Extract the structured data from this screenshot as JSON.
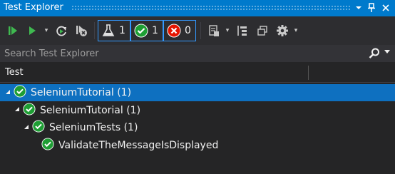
{
  "window": {
    "title": "Test Explorer"
  },
  "title_buttons": {
    "dropdown": "▾",
    "pin": "📌",
    "close": "✕"
  },
  "toolbar": {
    "run_all_icon": "run-all-icon",
    "run_icon": "run-icon",
    "repeat_icon": "repeat-run-icon",
    "cancel_icon": "cancel-icon",
    "filters": [
      {
        "icon": "flask-icon",
        "count": "1"
      },
      {
        "icon": "passed-icon",
        "count": "1"
      },
      {
        "icon": "failed-icon",
        "count": "0"
      }
    ],
    "caret": "▾"
  },
  "search": {
    "placeholder": "Search Test Explorer"
  },
  "header": {
    "test_col": "Test"
  },
  "tree": [
    {
      "label": "SeleniumTutorial  (1)",
      "level": 0,
      "selected": true
    },
    {
      "label": "SeleniumTutorial  (1)",
      "level": 1,
      "selected": false
    },
    {
      "label": "SeleniumTests  (1)",
      "level": 2,
      "selected": false
    },
    {
      "label": "ValidateTheMessageIsDisplayed",
      "level": 3,
      "selected": false
    }
  ],
  "colors": {
    "accent": "#007acc",
    "selection": "#0e70c0",
    "passed": "#1e9e34",
    "failed": "#e51400"
  }
}
